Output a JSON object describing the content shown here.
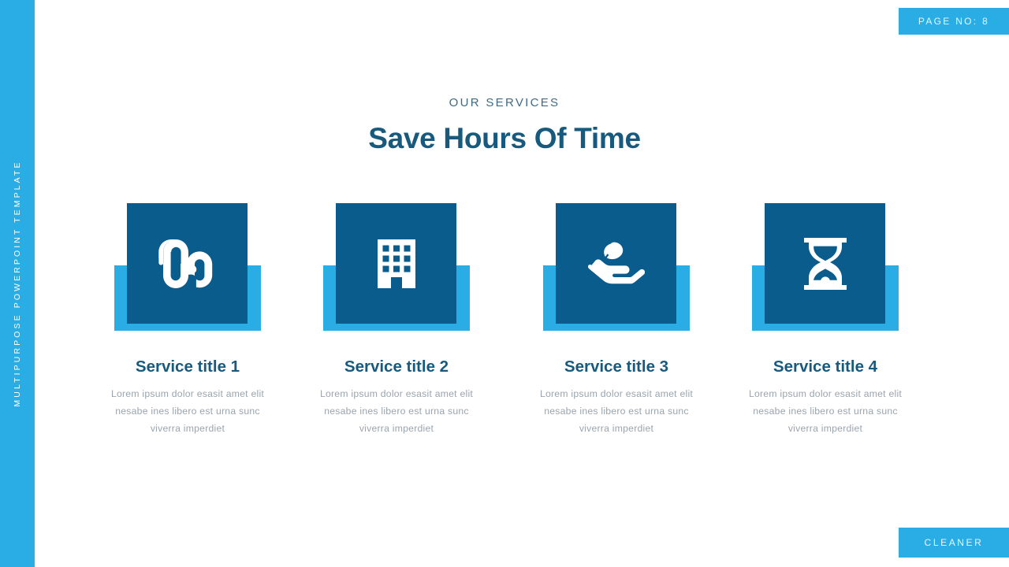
{
  "sidebar": {
    "label": "MULTIPURPOSE POWERPOINT TEMPLATE"
  },
  "badges": {
    "page": "PAGE NO: 8",
    "brand": "CLEANER"
  },
  "header": {
    "eyebrow": "OUR SERVICES",
    "headline": "Save Hours Of Time"
  },
  "colors": {
    "accent_light": "#29ade4",
    "accent_dark": "#0a5c8c",
    "heading": "#175a7e",
    "eyebrow": "#3e6b86",
    "body_text": "#9aa4ad",
    "background": "#ffffff"
  },
  "cards": [
    {
      "icon": "stumbleupon-icon",
      "title": "Service title 1",
      "body": "Lorem ipsum dolor esasit amet elit nesabe ines libero est urna sunc viverra imperdiet"
    },
    {
      "icon": "building-icon",
      "title": "Service title 2",
      "body": "Lorem ipsum dolor esasit amet elit nesabe ines libero est urna sunc viverra imperdiet"
    },
    {
      "icon": "hand-holding-leaf-icon",
      "title": "Service title 3",
      "body": "Lorem ipsum dolor esasit amet elit nesabe ines libero est urna sunc viverra imperdiet"
    },
    {
      "icon": "hourglass-icon",
      "title": "Service title 4",
      "body": "Lorem ipsum dolor esasit amet elit nesabe ines libero est urna sunc viverra imperdiet"
    }
  ]
}
